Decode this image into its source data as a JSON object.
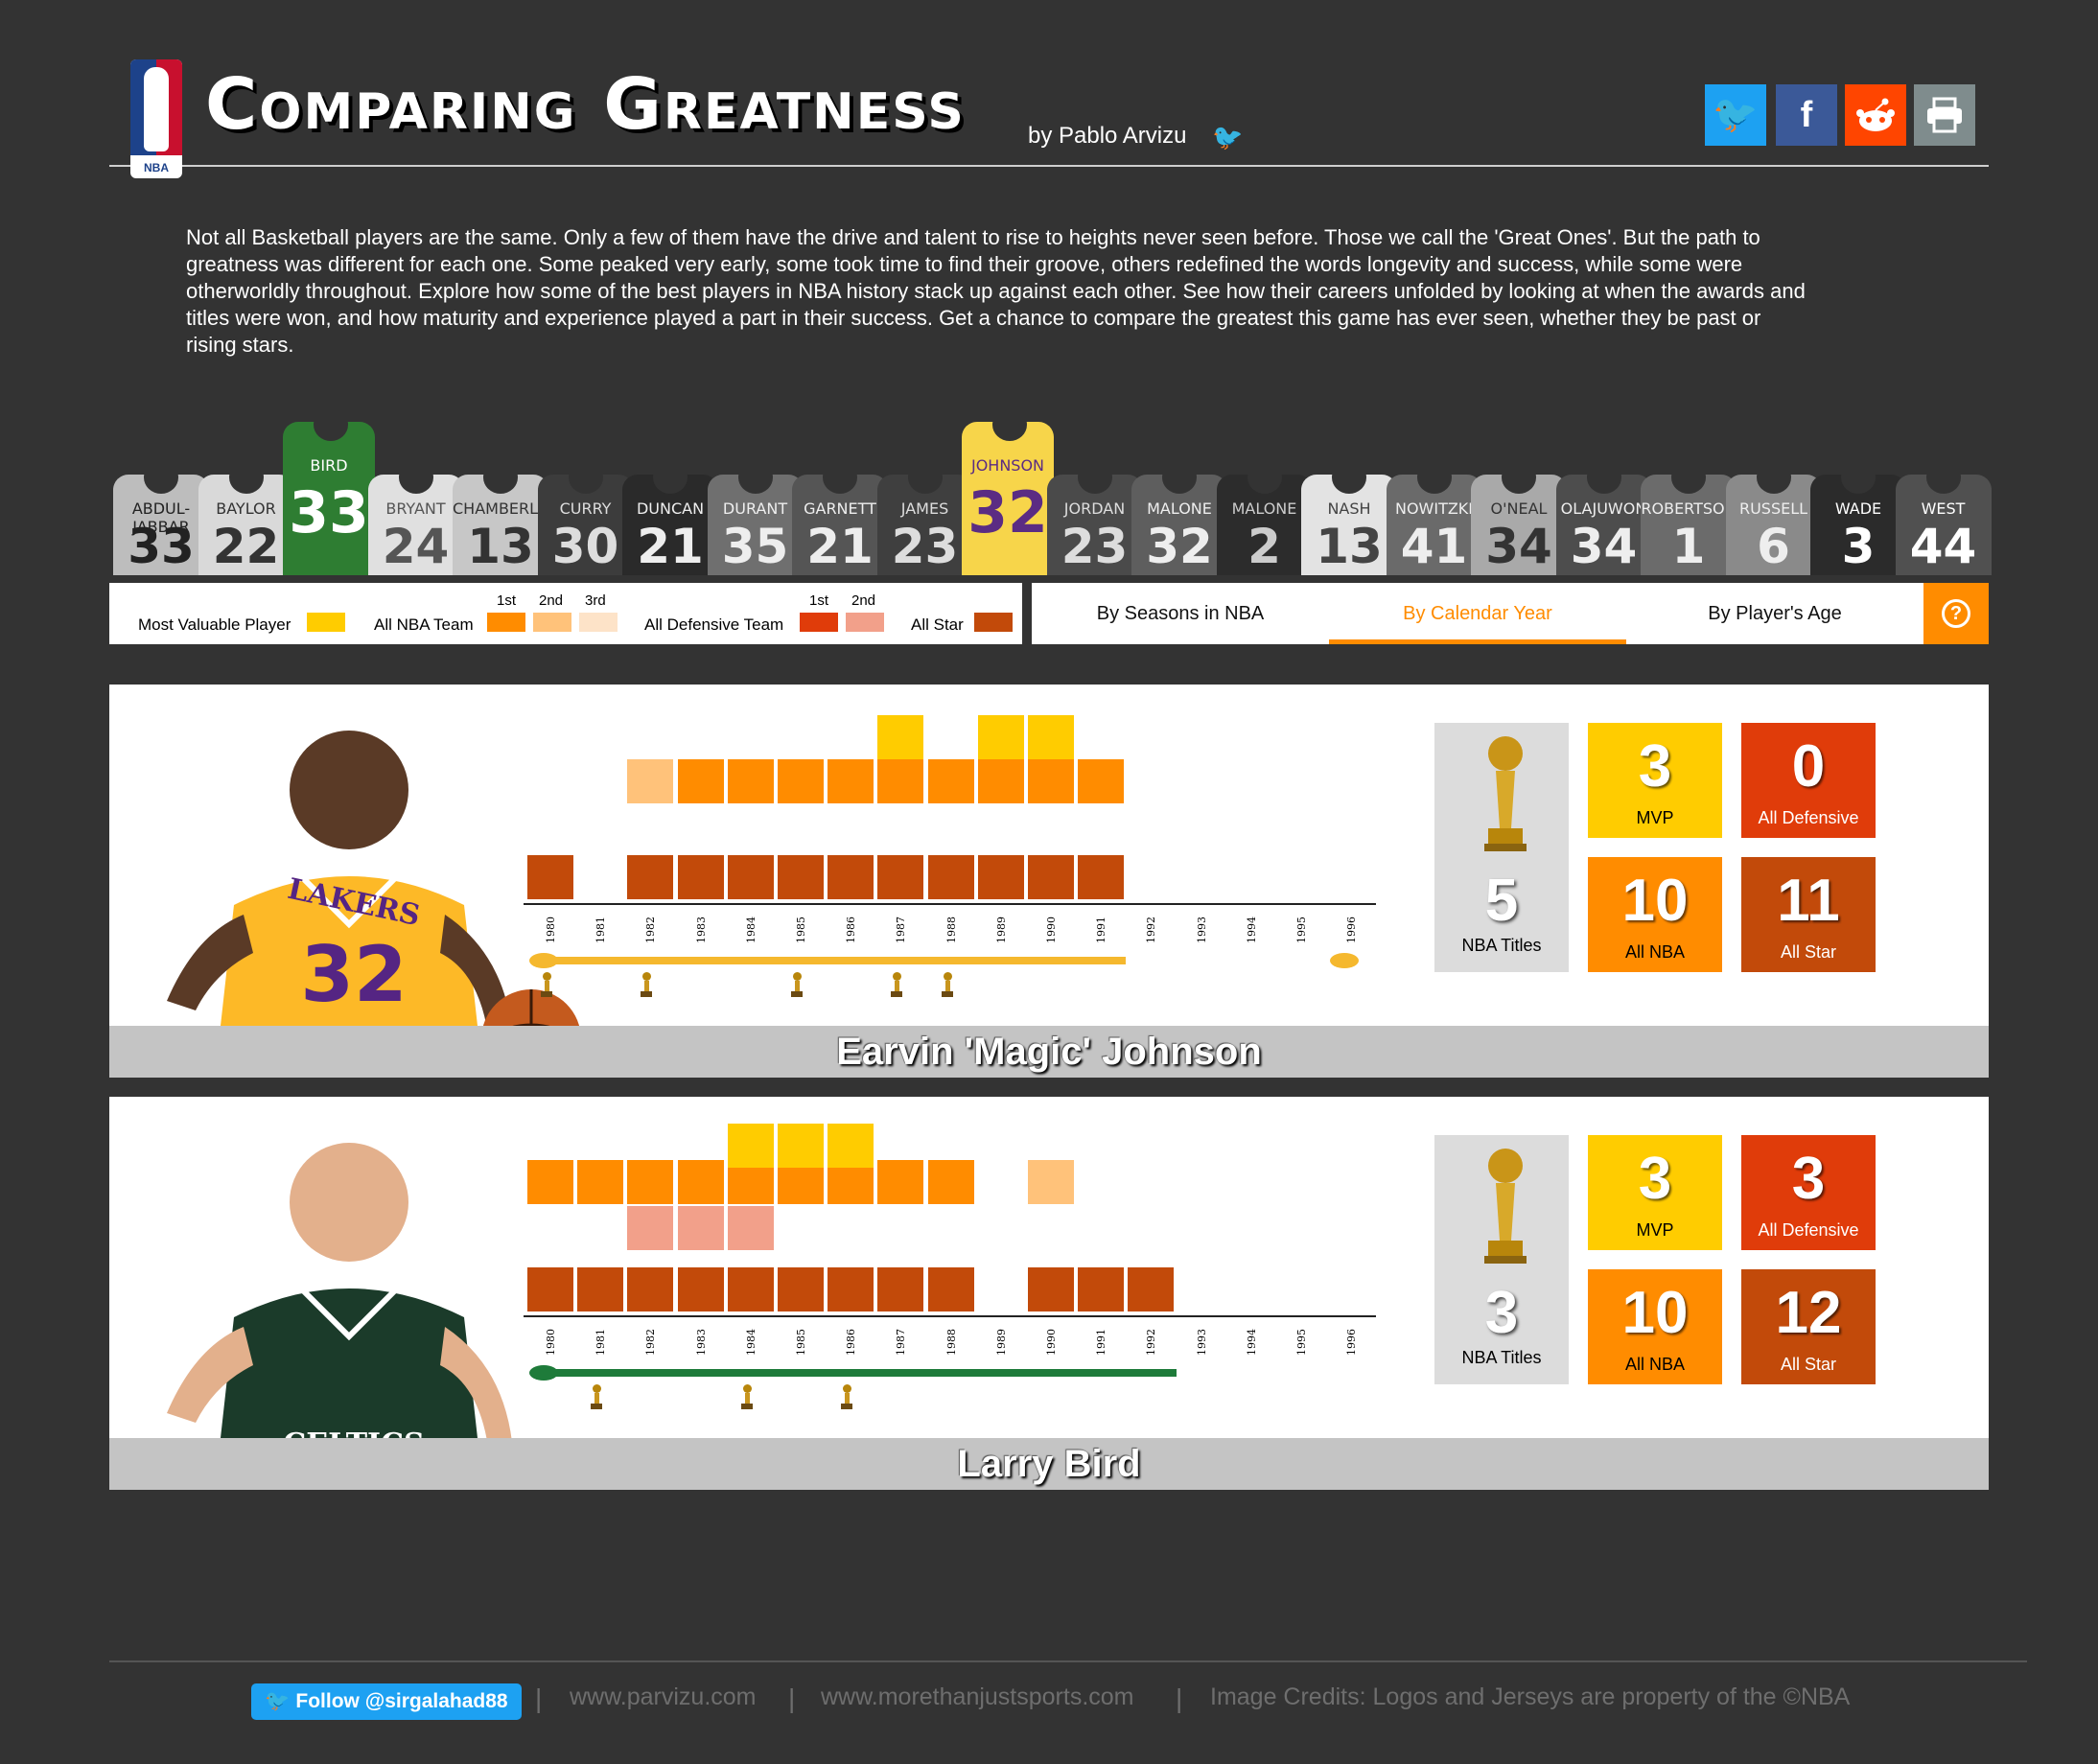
{
  "header": {
    "title": "Comparing Greatness",
    "byline": "by Pablo Arvizu",
    "logo_text": "NBA",
    "share": [
      {
        "name": "twitter",
        "glyph": "🐦",
        "color": "#1da1f2"
      },
      {
        "name": "facebook",
        "glyph": "f",
        "color": "#3b5998"
      },
      {
        "name": "reddit",
        "glyph": "●",
        "color": "#ff4500"
      },
      {
        "name": "print",
        "glyph": "⎙",
        "color": "#7f8c8d"
      }
    ]
  },
  "intro": "Not all Basketball players are the same. Only a few of them have the drive and talent to rise to heights never seen before. Those we call the 'Great Ones'. But the path to greatness was different for each one. Some peaked very early, some took time to find their groove, others redefined the words longevity and success, while some were otherworldly throughout. Explore how some of the best players in NBA history stack up against each other. See how their careers unfolded by looking at when the awards and titles were won, and how maturity and experience played a part in their success. Get a chance to compare the greatest this game has ever seen, whether they be past or rising stars.",
  "jerseys": [
    {
      "name": "ABDUL-JABBAR",
      "number": "33",
      "color": "#bdbdbd",
      "text": "#222"
    },
    {
      "name": "BAYLOR",
      "number": "22",
      "color": "#d9d9d9",
      "text": "#333"
    },
    {
      "name": "BIRD",
      "number": "33",
      "color": "#2e7d32",
      "text": "#fff",
      "selected": true
    },
    {
      "name": "BRYANT",
      "number": "24",
      "color": "#e0e0e0",
      "text": "#555"
    },
    {
      "name": "CHAMBERLAIN",
      "number": "13",
      "color": "#c7c7c7",
      "text": "#333"
    },
    {
      "name": "CURRY",
      "number": "30",
      "color": "#3c3c3c",
      "text": "#ddd"
    },
    {
      "name": "DUNCAN",
      "number": "21",
      "color": "#2a2a2a",
      "text": "#eee"
    },
    {
      "name": "DURANT",
      "number": "35",
      "color": "#6f6f6f",
      "text": "#eee"
    },
    {
      "name": "GARNETT",
      "number": "21",
      "color": "#555555",
      "text": "#eee"
    },
    {
      "name": "JAMES",
      "number": "23",
      "color": "#3f3f3f",
      "text": "#ddd"
    },
    {
      "name": "JOHNSON",
      "number": "32",
      "color": "#f7d54a",
      "text": "#5b2c83",
      "selected": true
    },
    {
      "name": "JORDAN",
      "number": "23",
      "color": "#4a4a4a",
      "text": "#ddd"
    },
    {
      "name": "MALONE",
      "number": "32",
      "color": "#5e5e5e",
      "text": "#eee"
    },
    {
      "name": "MALONE",
      "number": "2",
      "color": "#2c2c2c",
      "text": "#ccc"
    },
    {
      "name": "NASH",
      "number": "13",
      "color": "#e3e3e3",
      "text": "#444"
    },
    {
      "name": "NOWITZKI",
      "number": "41",
      "color": "#6a6a6a",
      "text": "#eee"
    },
    {
      "name": "O'NEAL",
      "number": "34",
      "color": "#a9a9a9",
      "text": "#333"
    },
    {
      "name": "OLAJUWON",
      "number": "34",
      "color": "#4d4d4d",
      "text": "#eee"
    },
    {
      "name": "ROBERTSON",
      "number": "1",
      "color": "#6b6b6b",
      "text": "#eee"
    },
    {
      "name": "RUSSELL",
      "number": "6",
      "color": "#8a8a8a",
      "text": "#eee"
    },
    {
      "name": "WADE",
      "number": "3",
      "color": "#2b2b2b",
      "text": "#fff"
    },
    {
      "name": "WEST",
      "number": "44",
      "color": "#505050",
      "text": "#fff"
    }
  ],
  "legend": {
    "mvp": "Most Valuable Player",
    "all_nba": "All NBA Team",
    "all_def": "All Defensive Team",
    "all_star": "All Star",
    "first": "1st",
    "second": "2nd",
    "third": "3rd",
    "colors": {
      "mvp": "#ffcc00",
      "nba1": "#ff8c00",
      "nba2": "#ffc27a",
      "nba3": "#fde3c8",
      "def1": "#e03c0a",
      "def2": "#f2a08a",
      "star": "#c24a0a"
    }
  },
  "tabs": {
    "seasons": "By Seasons in NBA",
    "calendar": "By Calendar Year",
    "age": "By Player's Age",
    "active": "calendar",
    "help": "?"
  },
  "years": [
    "1980",
    "1981",
    "1982",
    "1983",
    "1984",
    "1985",
    "1986",
    "1987",
    "1988",
    "1989",
    "1990",
    "1991",
    "1992",
    "1993",
    "1994",
    "1995",
    "1996"
  ],
  "players": [
    {
      "name": "Earvin 'Magic' Johnson",
      "career_color": "#f5b82e",
      "team_logo": "LAKERS",
      "team_logo_color": "#f5b82e",
      "career_start": "1980",
      "career_end": "1991",
      "return_year": "1996",
      "mvp": [
        "1987",
        "1989",
        "1990"
      ],
      "all_nba": [
        null,
        null,
        "2nd",
        "1st",
        "1st",
        "1st",
        "1st",
        "1st",
        "1st",
        "1st",
        "1st",
        "1st",
        null,
        null,
        null,
        null,
        null
      ],
      "all_def": [],
      "all_star": [
        "1980",
        "1982",
        "1983",
        "1984",
        "1985",
        "1986",
        "1987",
        "1988",
        "1989",
        "1990",
        "1991"
      ],
      "titles_years": [
        "1980",
        "1982",
        "1985",
        "1987",
        "1988"
      ],
      "stats": {
        "titles": "5",
        "titles_label": "NBA Titles",
        "mvp": "3",
        "mvp_label": "MVP",
        "def": "0",
        "def_label": "All Defensive",
        "nba": "10",
        "nba_label": "All NBA",
        "star": "11",
        "star_label": "All Star"
      },
      "photo": {
        "jersey": "#fdb927",
        "jersey_text": "LAKERS",
        "number": "32",
        "skin": "#5a3a26"
      }
    },
    {
      "name": "Larry Bird",
      "career_color": "#1e7b3a",
      "team_logo": "CELTICS",
      "team_logo_color": "#1e7b3a",
      "career_start": "1980",
      "career_end": "1992",
      "return_year": null,
      "mvp": [
        "1984",
        "1985",
        "1986"
      ],
      "all_nba": [
        "1st",
        "1st",
        "1st",
        "1st",
        "1st",
        "1st",
        "1st",
        "1st",
        "1st",
        null,
        "2nd",
        null,
        null,
        null,
        null,
        null,
        null
      ],
      "all_def": [
        null,
        null,
        "2nd",
        "2nd",
        "2nd",
        null,
        null,
        null,
        null,
        null,
        null,
        null,
        null,
        null,
        null,
        null,
        null
      ],
      "all_star": [
        "1980",
        "1981",
        "1982",
        "1983",
        "1984",
        "1985",
        "1986",
        "1987",
        "1988",
        "1990",
        "1991",
        "1992"
      ],
      "titles_years": [
        "1981",
        "1984",
        "1986"
      ],
      "stats": {
        "titles": "3",
        "titles_label": "NBA Titles",
        "mvp": "3",
        "mvp_label": "MVP",
        "def": "3",
        "def_label": "All Defensive",
        "nba": "10",
        "nba_label": "All NBA",
        "star": "12",
        "star_label": "All Star"
      },
      "photo": {
        "jersey": "#1b3b2a",
        "jersey_text": "CELTICS",
        "number": "",
        "skin": "#e3b08c"
      }
    }
  ],
  "footer": {
    "follow": "Follow @sirgalahad88",
    "link1": "www.parvizu.com",
    "link2": "www.morethanjustsports.com",
    "credits": "Image Credits: Logos and Jerseys are property of the ©NBA",
    "sep": "|"
  }
}
